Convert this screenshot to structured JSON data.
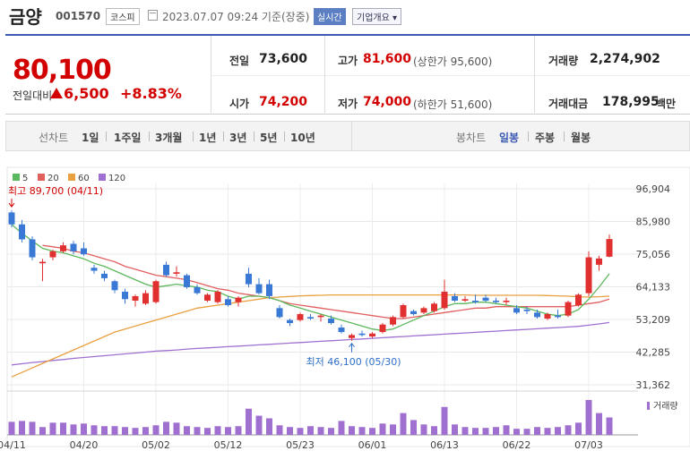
{
  "header": {
    "name": "금양",
    "code": "001570",
    "market": "코스피",
    "datetime": "2023.07.07 09:24 기준(장중)",
    "realtime": "실시간",
    "company_info": "기업개요"
  },
  "summary": {
    "price": "80,100",
    "change_label": "전일대비",
    "change": "6,500",
    "change_pct": "+8.83%",
    "prev_close_label": "전일",
    "prev_close": "73,600",
    "high_label": "고가",
    "high": "81,600",
    "upper_limit": "(상한가 95,600)",
    "volume_label": "거래량",
    "volume": "2,274,902",
    "open_label": "시가",
    "open": "74,200",
    "low_label": "저가",
    "low": "74,000",
    "lower_limit": "(하한가 51,600)",
    "amount_label": "거래대금",
    "amount": "178,995",
    "amount_unit": "백만"
  },
  "periods": {
    "line_label": "선차트",
    "line": [
      "1일",
      "1주일",
      "3개월",
      "1년",
      "3년",
      "5년",
      "10년"
    ],
    "candle_label": "봉차트",
    "candle": [
      "일봉",
      "주봉",
      "월봉"
    ],
    "active": "일봉"
  },
  "colors": {
    "up": "#e03030",
    "down": "#3a78d6",
    "ma5": "#5cb85c",
    "ma20": "#e06060",
    "ma60": "#e8a040",
    "ma120": "#a070d0",
    "volume": "#a070d0"
  },
  "chart_data": {
    "type": "candlestick",
    "legend": [
      {
        "name": "5",
        "color": "#5cb85c"
      },
      {
        "name": "20",
        "color": "#e06060"
      },
      {
        "name": "60",
        "color": "#e8a040"
      },
      {
        "name": "120",
        "color": "#a070d0"
      }
    ],
    "y_ticks": [
      "96,904",
      "85,980",
      "75,056",
      "64,133",
      "53,209",
      "42,285",
      "31,362"
    ],
    "y_tick_values": [
      96904,
      85980,
      75056,
      64133,
      53209,
      42285,
      31362
    ],
    "x_ticks": [
      "04/11",
      "04/20",
      "05/02",
      "05/12",
      "05/23",
      "06/01",
      "06/13",
      "06/22",
      "07/03"
    ],
    "x_tick_index": [
      0,
      7,
      14,
      21,
      28,
      35,
      42,
      49,
      56
    ],
    "volume_label": "거래량",
    "max_annotation": "최고 89,700 (04/11)",
    "min_annotation": "최저 46,100 (05/30)",
    "max_index": 0,
    "max_value": 89700,
    "min_index": 33,
    "min_value": 46100,
    "candles": [
      [
        89000,
        89700,
        84000,
        85000
      ],
      [
        85000,
        86500,
        79000,
        80000
      ],
      [
        80000,
        81000,
        73000,
        74000
      ],
      [
        72000,
        73500,
        66000,
        72500
      ],
      [
        74000,
        76500,
        73000,
        76000
      ],
      [
        76000,
        79000,
        75500,
        78000
      ],
      [
        78500,
        79500,
        75000,
        76000
      ],
      [
        77000,
        79000,
        74500,
        75000
      ],
      [
        70500,
        71500,
        68500,
        69500
      ],
      [
        68500,
        69500,
        66000,
        67000
      ],
      [
        66000,
        66500,
        62000,
        63000
      ],
      [
        62500,
        63500,
        58500,
        60000
      ],
      [
        59500,
        61500,
        57500,
        61000
      ],
      [
        58500,
        63000,
        58000,
        62000
      ],
      [
        59000,
        66500,
        58500,
        66000
      ],
      [
        71500,
        72500,
        67500,
        68000
      ],
      [
        68500,
        71000,
        67500,
        69000
      ],
      [
        68000,
        68500,
        63500,
        64000
      ],
      [
        64000,
        65000,
        61500,
        62000
      ],
      [
        59500,
        62000,
        59000,
        61500
      ],
      [
        59000,
        63000,
        58500,
        62500
      ],
      [
        60000,
        61000,
        57500,
        58000
      ],
      [
        59000,
        61000,
        57500,
        60500
      ],
      [
        68500,
        70500,
        64000,
        65000
      ],
      [
        65000,
        67000,
        61500,
        62000
      ],
      [
        65000,
        66500,
        60000,
        61000
      ],
      [
        57000,
        58000,
        53500,
        54000
      ],
      [
        53000,
        53500,
        51000,
        52000
      ],
      [
        53000,
        55500,
        52500,
        55000
      ],
      [
        54000,
        55000,
        53000,
        53500
      ],
      [
        54000,
        55000,
        52500,
        54500
      ],
      [
        53500,
        54500,
        51500,
        52000
      ],
      [
        50500,
        51500,
        48500,
        49000
      ],
      [
        47000,
        48500,
        46100,
        48000
      ],
      [
        48500,
        49500,
        47500,
        48000
      ],
      [
        47500,
        49000,
        47000,
        48500
      ],
      [
        49000,
        52000,
        48500,
        51500
      ],
      [
        51500,
        54500,
        51000,
        54000
      ],
      [
        54000,
        58500,
        53500,
        58000
      ],
      [
        56000,
        56500,
        54500,
        55000
      ],
      [
        55500,
        57500,
        55000,
        57000
      ],
      [
        56000,
        59000,
        55500,
        58500
      ],
      [
        57000,
        66500,
        56500,
        62500
      ],
      [
        61000,
        62000,
        59000,
        59500
      ],
      [
        59500,
        61000,
        59000,
        60000
      ],
      [
        59500,
        61500,
        58500,
        59000
      ],
      [
        60500,
        61500,
        59000,
        59500
      ],
      [
        59500,
        60500,
        58500,
        59000
      ],
      [
        59000,
        60500,
        58000,
        59500
      ],
      [
        57000,
        58000,
        55000,
        55500
      ],
      [
        56500,
        57500,
        55000,
        56000
      ],
      [
        55500,
        56500,
        53500,
        54000
      ],
      [
        53500,
        55500,
        53000,
        55000
      ],
      [
        54500,
        56500,
        53500,
        54000
      ],
      [
        54500,
        59500,
        54000,
        59000
      ],
      [
        58000,
        62000,
        57500,
        61500
      ],
      [
        62000,
        76000,
        61000,
        74000
      ],
      [
        71500,
        74500,
        69500,
        73600
      ],
      [
        74200,
        81600,
        74000,
        80100
      ]
    ],
    "volume": [
      15,
      16,
      15,
      9,
      14,
      14,
      12,
      13,
      11,
      10,
      10,
      9,
      8,
      9,
      11,
      15,
      14,
      10,
      9,
      8,
      10,
      9,
      10,
      30,
      22,
      19,
      11,
      9,
      8,
      10,
      9,
      8,
      16,
      10,
      9,
      8,
      13,
      12,
      25,
      17,
      12,
      10,
      32,
      12,
      9,
      8,
      8,
      9,
      11,
      7,
      7,
      9,
      8,
      9,
      11,
      14,
      40,
      25,
      20
    ],
    "ma5": [
      85000,
      82000,
      79500,
      77000,
      76000,
      75500,
      74500,
      73500,
      72000,
      71000,
      69500,
      68000,
      66500,
      65000,
      64000,
      64500,
      65000,
      64500,
      64000,
      63000,
      62500,
      61000,
      60000,
      61000,
      61000,
      60500,
      59500,
      58000,
      57000,
      56000,
      55000,
      54000,
      53000,
      52000,
      51000,
      50000,
      49500,
      50000,
      51500,
      53000,
      54500,
      56000,
      57500,
      58500,
      58500,
      59000,
      59000,
      58500,
      58000,
      57500,
      57000,
      56000,
      55000,
      54500,
      55000,
      56500,
      60000,
      64000,
      68500
    ],
    "ma20": [
      null,
      null,
      null,
      78000,
      77500,
      77000,
      76000,
      75500,
      74500,
      73500,
      72500,
      71000,
      70000,
      69000,
      68000,
      67500,
      67000,
      66500,
      65500,
      64500,
      63500,
      63000,
      62000,
      61500,
      61000,
      60500,
      59500,
      58500,
      58000,
      57500,
      57000,
      56500,
      56000,
      55500,
      55000,
      54500,
      54000,
      53500,
      53500,
      54000,
      54500,
      55000,
      55500,
      56000,
      56500,
      57000,
      57000,
      57500,
      57500,
      57500,
      57500,
      57500,
      57500,
      57500,
      57500,
      58000,
      58500,
      59000,
      60000
    ],
    "ma60": [
      34000,
      35500,
      37000,
      38500,
      40000,
      41500,
      43000,
      44500,
      46000,
      47500,
      49000,
      50000,
      51000,
      52000,
      53000,
      54000,
      55000,
      56000,
      57000,
      57500,
      58000,
      58500,
      59000,
      59500,
      60000,
      60500,
      60700,
      60900,
      61100,
      61200,
      61300,
      61400,
      61400,
      61400,
      61400,
      61400,
      61400,
      61400,
      61400,
      61400,
      61400,
      61400,
      61400,
      61400,
      61400,
      61300,
      61300,
      61300,
      61300,
      61300,
      61300,
      61300,
      61200,
      61100,
      61000,
      60800,
      60700,
      60800,
      61000
    ],
    "ma120": [
      38000,
      38400,
      38800,
      39100,
      39500,
      39800,
      40200,
      40500,
      40800,
      41100,
      41400,
      41700,
      42000,
      42300,
      42600,
      42800,
      43000,
      43300,
      43500,
      43700,
      43900,
      44100,
      44300,
      44500,
      44700,
      44900,
      45100,
      45300,
      45500,
      45700,
      45900,
      46100,
      46300,
      46500,
      46700,
      46900,
      47100,
      47300,
      47500,
      47700,
      47900,
      48100,
      48300,
      48500,
      48700,
      48900,
      49100,
      49300,
      49500,
      49700,
      49900,
      50100,
      50300,
      50500,
      50700,
      50900,
      51300,
      51700,
      52200
    ]
  }
}
